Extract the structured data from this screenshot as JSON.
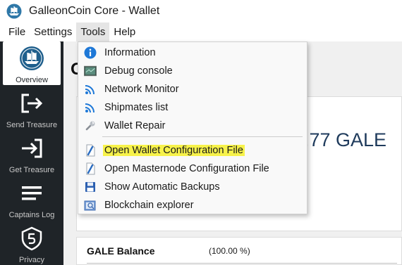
{
  "window": {
    "title": "GalleonCoin Core - Wallet",
    "app_icon": "galleon-ship-icon"
  },
  "menubar": {
    "items": [
      "File",
      "Settings",
      "Tools",
      "Help"
    ],
    "open_menu": "Tools"
  },
  "sidebar": {
    "items": [
      {
        "label": "Overview",
        "icon": "ship-wheel-icon",
        "active": true
      },
      {
        "label": "Send Treasure",
        "icon": "send-arrow-icon",
        "active": false
      },
      {
        "label": "Get Treasure",
        "icon": "receive-arrow-icon",
        "active": false
      },
      {
        "label": "Captains Log",
        "icon": "list-lines-icon",
        "active": false
      },
      {
        "label": "Privacy",
        "icon": "shield-s-icon",
        "active": false
      }
    ]
  },
  "main": {
    "title_partial": "O",
    "balance_partial": ".77 GALE",
    "gale_balance_label": "GALE Balance",
    "gale_balance_percent": "(100.00 %)"
  },
  "tools_menu": {
    "items": [
      {
        "label": "Information",
        "icon": "info-icon"
      },
      {
        "label": "Debug console",
        "icon": "console-icon"
      },
      {
        "label": "Network Monitor",
        "icon": "network-signal-icon"
      },
      {
        "label": "Shipmates list",
        "icon": "peers-signal-icon"
      },
      {
        "label": "Wallet Repair",
        "icon": "wrench-icon"
      },
      {
        "label": "Open Wallet Configuration File",
        "icon": "config-file-icon",
        "highlighted": true
      },
      {
        "label": "Open Masternode Configuration File",
        "icon": "config-file-icon"
      },
      {
        "label": "Show Automatic Backups",
        "icon": "floppy-disk-icon"
      },
      {
        "label": "Blockchain explorer",
        "icon": "explorer-book-icon"
      }
    ]
  },
  "colors": {
    "sidebar_bg": "#1f2428",
    "highlight": "#f7f24a",
    "balance_text": "#1f3b5c",
    "info_blue": "#1e78d7"
  }
}
